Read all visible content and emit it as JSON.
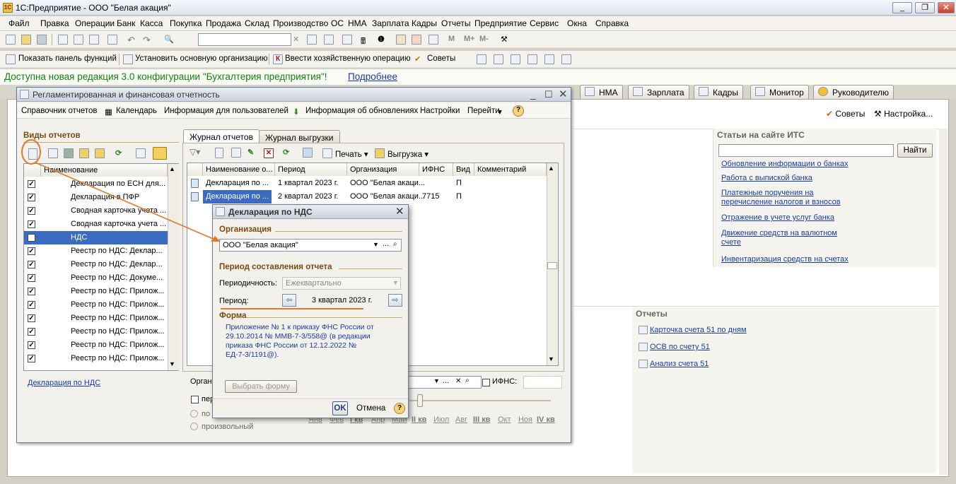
{
  "app": {
    "title": "1С:Предприятие - ООО \"Белая акация\"",
    "icon_text": "1C"
  },
  "window_controls": [
    "_",
    "❐",
    "✕"
  ],
  "menu": [
    "Файл",
    "Правка",
    "Операции",
    "Банк",
    "Касса",
    "Покупка",
    "Продажа",
    "Склад",
    "Производство",
    "ОС",
    "НМА",
    "Зарплата",
    "Кадры",
    "Отчеты",
    "Предприятие",
    "Сервис",
    "Окна",
    "Справка"
  ],
  "toolbar2": {
    "show_panel": "Показать панель функций",
    "set_org": "Установить основную организацию",
    "enter_op": "Ввести хозяйственную операцию",
    "tips": "Советы"
  },
  "notice": {
    "text": "Доступна новая редакция 3.0 конфигурации \"Бухгалтерия предприятия\"!",
    "link": "Подробнее"
  },
  "app_tabs": [
    "НМА",
    "Зарплата",
    "Кадры",
    "Монитор",
    "Руководителю"
  ],
  "workspace": {
    "tips": "Советы",
    "settings": "Настройка...",
    "its": {
      "title": "Статьи на сайте ИТС",
      "find": "Найти",
      "links": [
        "Обновление информации о банках",
        "Работа с выпиской банка",
        "Платежные поручения на",
        "перечисление налогов и взносов",
        "Отражение в учете услуг банка",
        "Движение средств на валютном",
        "счете",
        "Инвентаризация средств на счетах"
      ]
    },
    "reports": {
      "title": "Отчеты",
      "links": [
        "Карточка счета 51 по дням",
        "ОСВ по счету 51",
        "Анализ счета 51"
      ]
    }
  },
  "reg": {
    "title": "Регламентированная и финансовая отчетность",
    "menu": [
      "Справочник отчетов",
      "Календарь",
      "Информация для пользователей",
      "Информация об обновлениях",
      "Настройки",
      "Перейти"
    ],
    "kinds_title": "Виды отчетов",
    "col_name": "Наименование",
    "kinds": [
      {
        "label": "Декларация по ЕСН для..."
      },
      {
        "label": "Декларация в ПФР"
      },
      {
        "label": "Сводная карточка учета ..."
      },
      {
        "label": "Сводная карточка учета ..."
      },
      {
        "label": "НДС"
      },
      {
        "label": "Реестр по НДС: Деклар..."
      },
      {
        "label": "Реестр по НДС: Деклар..."
      },
      {
        "label": "Реестр по НДС: Докуме..."
      },
      {
        "label": "Реестр по НДС: Прилож..."
      },
      {
        "label": "Реестр по НДС: Прилож..."
      },
      {
        "label": "Реестр по НДС: Прилож..."
      },
      {
        "label": "Реестр по НДС: Прилож..."
      },
      {
        "label": "Реестр по НДС: Прилож..."
      },
      {
        "label": "Реестр по НДС: Прилож..."
      }
    ],
    "selected_desc": "Декларация по НДС",
    "tabs": [
      "Журнал отчетов",
      "Журнал выгрузки"
    ],
    "journal_toolbar": {
      "print": "Печать",
      "export": "Выгрузка"
    },
    "journal_cols": [
      "Наименование о...",
      "Период",
      "Организация",
      "ИФНС",
      "Вид",
      "Комментарий"
    ],
    "journal_rows": [
      [
        "Декларация по ...",
        "1 квартал 2023 г.",
        "ООО \"Белая акаци...",
        "",
        "П",
        ""
      ],
      [
        "Декларация по ...",
        "2 квартал 2023 г.",
        "ООО \"Белая акаци...",
        "7715",
        "П",
        ""
      ]
    ],
    "filter": {
      "org_label": "Орган",
      "ifns_label": "ИФНС:",
      "per_label": "пер",
      "po_label": "по",
      "arbitrary": "произвольный"
    },
    "months": [
      "Янв",
      "Фев",
      "I кв",
      "Апр",
      "Май",
      "II кв",
      "Июл",
      "Авг",
      "III кв",
      "Окт",
      "Ноя",
      "IV кв"
    ]
  },
  "dialog": {
    "title": "Декларация по НДС",
    "org_section": "Организация",
    "org_value": "ООО \"Белая акация\"",
    "period_section": "Период составления отчета",
    "periodicity_label": "Периодичность:",
    "periodicity_value": "Ежеквартально",
    "period_label": "Период:",
    "period_value": "3 квартал 2023 г.",
    "form_section": "Форма",
    "form_text": [
      "Приложение № 1 к приказу ФНС России от",
      "29.10.2014 № ММВ-7-3/558@ (в редакции",
      "приказа ФНС России от 12.12.2022 №",
      "ЕД-7-3/1191@)."
    ],
    "choose_form": "Выбрать форму",
    "ok": "OK",
    "cancel": "Отмена",
    "help": "?"
  },
  "accent": {
    "orange": "#e07a2a",
    "link": "#1a3ca8",
    "notice": "#108010",
    "selection": "#3d6bc4"
  }
}
